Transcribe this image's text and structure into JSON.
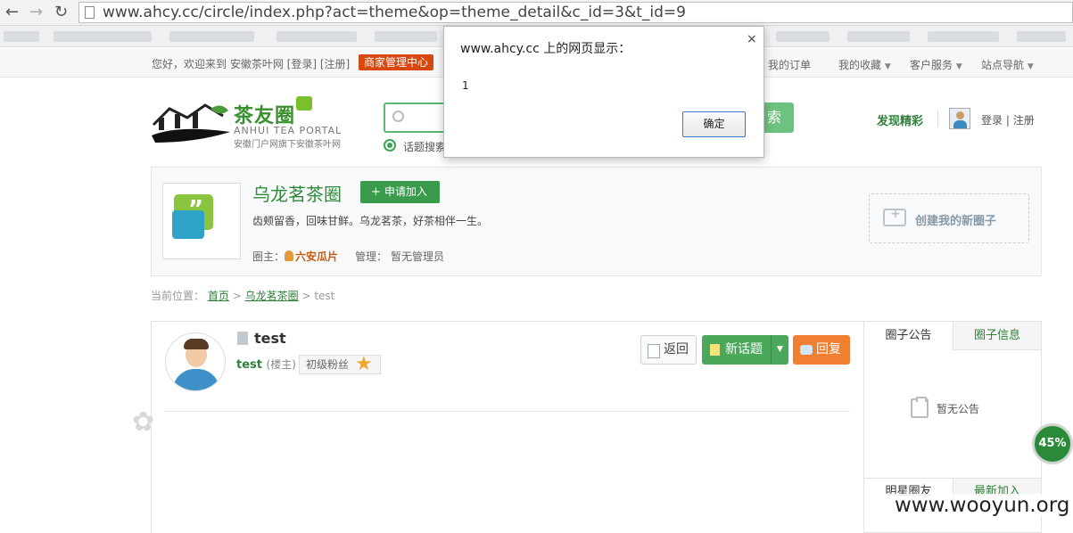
{
  "browser": {
    "url": "www.ahcy.cc/circle/index.php?act=theme&op=theme_detail&c_id=3&t_id=9"
  },
  "topbar": {
    "welcome": "您好，欢迎来到 安徽茶叶网",
    "login": "[登录]",
    "register": "[注册]",
    "merchant": "商家管理中心",
    "links": [
      "我的订单",
      "我的收藏",
      "客户服务",
      "站点导航"
    ]
  },
  "header": {
    "logo_name": "茶友圈",
    "logo_en": "ANHUI TEA PORTAL",
    "logo_sub": "安徽门户网旗下安徽茶叶网",
    "search_btn": "索",
    "topic_search": "话题搜索",
    "discover": "发现精彩",
    "login": "登录",
    "sep": "|",
    "register": "注册"
  },
  "circle": {
    "title": "乌龙茗茶圈",
    "join": "申请加入",
    "desc": "齿颊留香，回味甘鲜。乌龙茗茶，好茶相伴一生。",
    "owner_label": "圈主：",
    "owner_name": "六安瓜片",
    "admin_label": "管理：",
    "admin_value": "暂无管理员",
    "create": "创建我的新圈子"
  },
  "breadcrumb": {
    "label": "当前位置：",
    "home": "首页",
    "circle": "乌龙茗茶圈",
    "current": "test",
    "sep": ">"
  },
  "thread": {
    "title": "test",
    "poster": "test",
    "poster_role": "(楼主)",
    "fan_level": "初级粉丝",
    "back": "返回",
    "new_topic": "新话题",
    "reply": "回复"
  },
  "side": {
    "tab_notice": "圈子公告",
    "tab_info": "圈子信息",
    "no_notice": "暂无公告",
    "tab_stars": "明星圈友",
    "tab_latest": "最新加入"
  },
  "progress": "45%",
  "watermark": "www.wooyun.org",
  "dialog": {
    "title": "www.ahcy.cc 上的网页显示：",
    "close": "×",
    "message": "1",
    "ok": "确定"
  }
}
